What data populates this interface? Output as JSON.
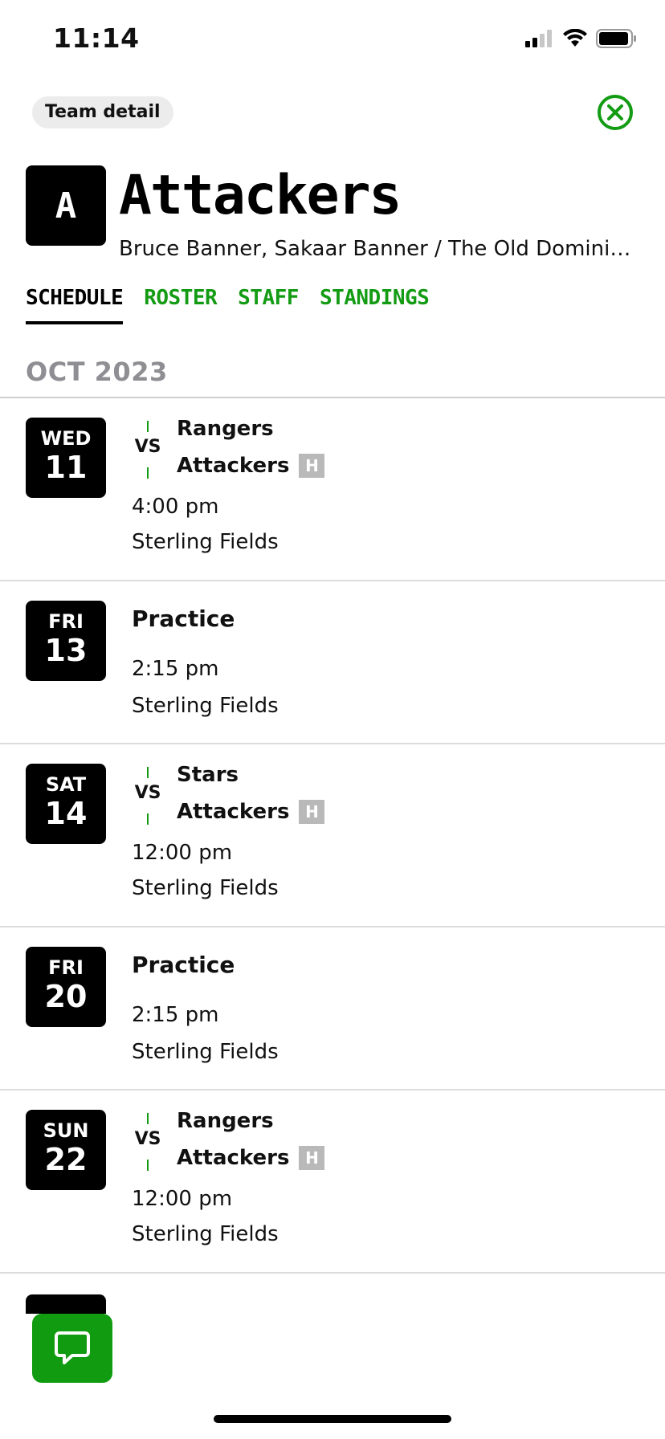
{
  "status_bar": {
    "time": "11:14"
  },
  "header": {
    "chip_label": "Team detail",
    "accent_color": "#139b13"
  },
  "team": {
    "avatar_letter": "A",
    "name": "Attackers",
    "subtitle": "Bruce Banner, Sakaar Banner / The Old Dominio..."
  },
  "tabs": [
    {
      "label": "SCHEDULE",
      "active": true
    },
    {
      "label": "ROSTER",
      "active": false
    },
    {
      "label": "STAFF",
      "active": false
    },
    {
      "label": "STANDINGS",
      "active": false
    }
  ],
  "schedule": {
    "month": "OCT 2023",
    "events": [
      {
        "type": "game",
        "dow": "WED",
        "day": "11",
        "vs": "VS",
        "opponent": "Rangers",
        "home_team": "Attackers",
        "home_badge": "H",
        "time": "4:00 pm",
        "location": "Sterling Fields"
      },
      {
        "type": "practice",
        "dow": "FRI",
        "day": "13",
        "title": "Practice",
        "time": "2:15 pm",
        "location": "Sterling Fields"
      },
      {
        "type": "game",
        "dow": "SAT",
        "day": "14",
        "vs": "VS",
        "opponent": "Stars",
        "home_team": "Attackers",
        "home_badge": "H",
        "time": "12:00 pm",
        "location": "Sterling Fields"
      },
      {
        "type": "practice",
        "dow": "FRI",
        "day": "20",
        "title": "Practice",
        "time": "2:15 pm",
        "location": "Sterling Fields"
      },
      {
        "type": "game",
        "dow": "SUN",
        "day": "22",
        "vs": "VS",
        "opponent": "Rangers",
        "home_team": "Attackers",
        "home_badge": "H",
        "time": "12:00 pm",
        "location": "Sterling Fields"
      }
    ]
  },
  "icons": {
    "close": "close-circle-icon",
    "chat": "chat-bubble-icon",
    "signal": "signal-icon",
    "wifi": "wifi-icon",
    "battery": "battery-icon"
  }
}
